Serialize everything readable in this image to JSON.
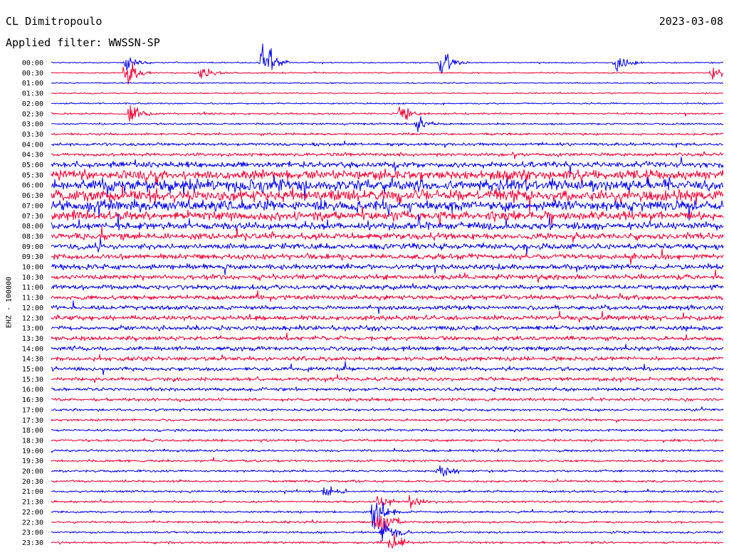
{
  "header": {
    "station": "CL Dimitropoulo",
    "date": "2023-03-08",
    "filter": "Applied filter: WWSSN-SP"
  },
  "channel_label": "EHZ - 100000",
  "colors": {
    "trace_a": "#0000ff",
    "trace_b": "#ff0033",
    "background": "#ffffff"
  },
  "chart_data": {
    "type": "line",
    "title": "",
    "ylabel": "EHZ - 100000",
    "row_labels": [
      "00:00",
      "00:30",
      "01:00",
      "01:30",
      "02:00",
      "02:30",
      "03:00",
      "03:30",
      "04:00",
      "04:30",
      "05:00",
      "05:30",
      "06:00",
      "06:30",
      "07:00",
      "07:30",
      "08:00",
      "08:30",
      "09:00",
      "09:30",
      "10:00",
      "10:30",
      "11:00",
      "11:30",
      "12:00",
      "12:30",
      "13:00",
      "13:30",
      "14:00",
      "14:30",
      "15:00",
      "15:30",
      "16:00",
      "16:30",
      "17:00",
      "17:30",
      "18:00",
      "18:30",
      "19:00",
      "19:30",
      "20:00",
      "20:30",
      "21:00",
      "21:30",
      "22:00",
      "22:30",
      "23:00",
      "23:30"
    ],
    "series": [
      {
        "color": "#0000ff",
        "rows": "00:00, 01:00, 02:00 ... 23:00"
      },
      {
        "color": "#ff0033",
        "rows": "00:30, 01:30, 02:30 ... 23:30"
      }
    ],
    "row_noise_level": [
      0.3,
      0.3,
      0.3,
      0.3,
      0.35,
      0.4,
      0.45,
      0.55,
      0.7,
      0.8,
      1.4,
      2.2,
      2.6,
      2.6,
      2.4,
      2.1,
      1.7,
      1.5,
      1.4,
      1.3,
      1.25,
      1.2,
      1.15,
      1.1,
      1.1,
      1.1,
      1.05,
      1.0,
      1.0,
      1.0,
      0.95,
      0.9,
      0.8,
      0.7,
      0.6,
      0.55,
      0.55,
      0.55,
      0.55,
      0.55,
      0.5,
      0.5,
      0.5,
      0.5,
      0.5,
      0.5,
      0.5,
      0.5
    ],
    "events": [
      {
        "row": "00:00",
        "minute": 3.3,
        "amplitude": 2.5
      },
      {
        "row": "00:00",
        "minute": 9.4,
        "amplitude": 6.5
      },
      {
        "row": "00:00",
        "minute": 17.4,
        "amplitude": 3.0
      },
      {
        "row": "00:00",
        "minute": 25.2,
        "amplitude": 3.0
      },
      {
        "row": "00:30",
        "minute": 3.3,
        "amplitude": 4.5
      },
      {
        "row": "00:30",
        "minute": 6.7,
        "amplitude": 2.5
      },
      {
        "row": "00:30",
        "minute": 29.5,
        "amplitude": 2.0
      },
      {
        "row": "02:30",
        "minute": 3.5,
        "amplitude": 2.5
      },
      {
        "row": "02:30",
        "minute": 15.6,
        "amplitude": 2.5
      },
      {
        "row": "03:00",
        "minute": 16.3,
        "amplitude": 2.5
      },
      {
        "row": "20:00",
        "minute": 17.3,
        "amplitude": 2.2
      },
      {
        "row": "21:00",
        "minute": 12.2,
        "amplitude": 2.0
      },
      {
        "row": "21:30",
        "minute": 14.6,
        "amplitude": 2.5
      },
      {
        "row": "21:30",
        "minute": 16.0,
        "amplitude": 2.0
      },
      {
        "row": "22:00",
        "minute": 14.4,
        "amplitude": 6.0
      },
      {
        "row": "22:30",
        "minute": 14.6,
        "amplitude": 5.0
      },
      {
        "row": "23:00",
        "minute": 14.8,
        "amplitude": 3.5
      },
      {
        "row": "23:30",
        "minute": 15.1,
        "amplitude": 2.5
      }
    ]
  }
}
